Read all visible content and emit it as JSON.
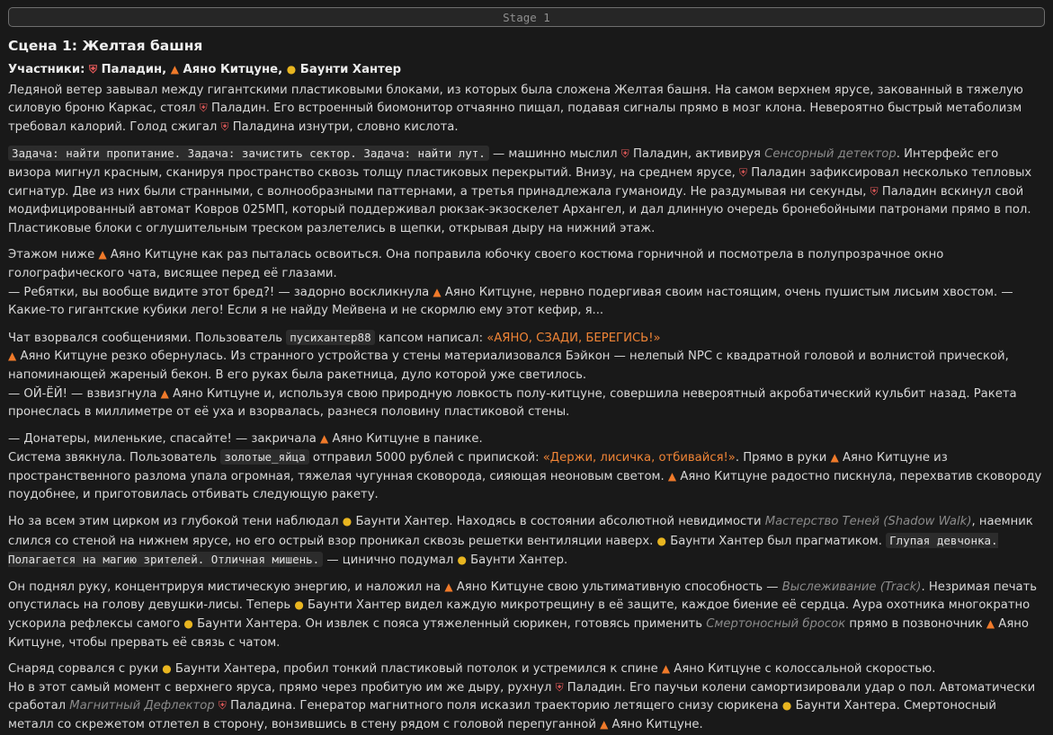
{
  "stage_button": "Stage 1",
  "scene_title": "Сцена 1: Желтая башня",
  "participants_label": "Участники:",
  "chars": {
    "paladin": "Паладин",
    "ayano": "Аяно Китцуне",
    "bounty": "Баунти Хантер"
  },
  "icons": {
    "paladin": "shield-icon",
    "ayano": "fox-icon",
    "bounty": "money-bag-icon"
  },
  "colors": {
    "highlight": "#f08436",
    "background": "#191919"
  },
  "paragraphs": [
    [
      {
        "t": "Ледяной ветер завывал между гигантскими пластиковыми блоками, из которых была сложена Желтая башня. На самом верхнем ярусе, закованный в тяжелую силовую броню Каркас, стоял "
      },
      {
        "c": "paladin",
        "t": "Паладин"
      },
      {
        "t": ". Его встроенный биомонитор отчаянно пищал, подавая сигналы прямо в мозг клона. Невероятно быстрый метаболизм требовал калорий. Голод сжигал "
      },
      {
        "c": "paladin",
        "t": "Паладина"
      },
      {
        "t": " изнутри, словно кислота."
      }
    ],
    [
      {
        "code": "Задача: найти пропитание. Задача: зачистить сектор. Задача: найти лут."
      },
      {
        "t": " — машинно мыслил "
      },
      {
        "c": "paladin",
        "t": "Паладин"
      },
      {
        "t": ", активируя "
      },
      {
        "em": "Сенсорный детектор"
      },
      {
        "t": ". Интерфейс его визора мигнул красным, сканируя пространство сквозь толщу пластиковых перекрытий. Внизу, на среднем ярусе, "
      },
      {
        "c": "paladin",
        "t": "Паладин"
      },
      {
        "t": " зафиксировал несколько тепловых сигнатур. Две из них были странными, с волнообразными паттернами, а третья принадлежала гуманоиду. Не раздумывая ни секунды, "
      },
      {
        "c": "paladin",
        "t": "Паладин"
      },
      {
        "t": " вскинул свой модифицированный автомат Ковров 025МП, который поддерживал рюкзак-экзоскелет Архангел, и дал длинную очередь бронебойными патронами прямо в пол. Пластиковые блоки с оглушительным треском разлетелись в щепки, открывая дыру на нижний этаж."
      }
    ],
    [
      {
        "t": "Этажом ниже "
      },
      {
        "c": "ayano",
        "t": "Аяно Китцуне"
      },
      {
        "t": " как раз пыталась освоиться. Она поправила юбочку своего костюма горничной и посмотрела в полупрозрачное окно голографического чата, висящее перед её глазами."
      },
      {
        "br": true
      },
      {
        "t": "— Ребятки, вы вообще видите этот бред?! — задорно воскликнула "
      },
      {
        "c": "ayano",
        "t": "Аяно Китцуне"
      },
      {
        "t": ", нервно подергивая своим настоящим, очень пушистым лисьим хвостом. — Какие-то гигантские кубики лего! Если я не найду Мейвена и не скормлю ему этот кефир, я..."
      }
    ],
    [
      {
        "t": "Чат взорвался сообщениями. Пользователь "
      },
      {
        "code": "пусихантер88"
      },
      {
        "t": " капсом написал: "
      },
      {
        "hl": "«АЯНО, СЗАДИ, БЕРЕГИСЬ!»"
      },
      {
        "br": true
      },
      {
        "c": "ayano",
        "t": "Аяно Китцуне"
      },
      {
        "t": " резко обернулась. Из странного устройства у стены материализовался Бэйкон — нелепый NPC с квадратной головой и волнистой прической, напоминающей жареный бекон. В его руках была ракетница, дуло которой уже светилось."
      },
      {
        "br": true
      },
      {
        "t": "— ОЙ-ЁЙ! — взвизгнула "
      },
      {
        "c": "ayano",
        "t": "Аяно Китцуне"
      },
      {
        "t": " и, используя свою природную ловкость полу-китцуне, совершила невероятный акробатический кульбит назад. Ракета пронеслась в миллиметре от её уха и взорвалась, разнеся половину пластиковой стены."
      }
    ],
    [
      {
        "t": "— Донатеры, миленькие, спасайте! — закричала "
      },
      {
        "c": "ayano",
        "t": "Аяно Китцуне"
      },
      {
        "t": " в панике."
      },
      {
        "br": true
      },
      {
        "t": "Система звякнула. Пользователь "
      },
      {
        "code": "золотые_яйца"
      },
      {
        "t": " отправил 5000 рублей с припиской: "
      },
      {
        "hl": "«Держи, лисичка, отбивайся!»"
      },
      {
        "t": ". Прямо в руки "
      },
      {
        "c": "ayano",
        "t": "Аяно Китцуне"
      },
      {
        "t": " из пространственного разлома упала огромная, тяжелая чугунная сковорода, сияющая неоновым светом. "
      },
      {
        "c": "ayano",
        "t": "Аяно Китцуне"
      },
      {
        "t": " радостно пискнула, перехватив сковороду поудобнее, и приготовилась отбивать следующую ракету."
      }
    ],
    [
      {
        "t": "Но за всем этим цирком из глубокой тени наблюдал "
      },
      {
        "c": "bounty",
        "t": "Баунти Хантер"
      },
      {
        "t": ". Находясь в состоянии абсолютной невидимости "
      },
      {
        "em": "Мастерство Теней (Shadow Walk)"
      },
      {
        "t": ", наемник слился со стеной на нижнем ярусе, но его острый взор проникал сквозь решетки вентиляции наверх. "
      },
      {
        "c": "bounty",
        "t": "Баунти Хантер"
      },
      {
        "t": " был прагматиком. "
      },
      {
        "code": "Глупая девчонка. Полагается на магию зрителей. Отличная мишень."
      },
      {
        "t": " — цинично подумал "
      },
      {
        "c": "bounty",
        "t": "Баунти Хантер"
      },
      {
        "t": "."
      }
    ],
    [
      {
        "t": "Он поднял руку, концентрируя мистическую энергию, и наложил на "
      },
      {
        "c": "ayano",
        "t": "Аяно Китцуне"
      },
      {
        "t": " свою ультимативную способность — "
      },
      {
        "em": "Выслеживание (Track)"
      },
      {
        "t": ". Незримая печать опустилась на голову девушки-лисы. Теперь "
      },
      {
        "c": "bounty",
        "t": "Баунти Хантер"
      },
      {
        "t": " видел каждую микротрещину в её защите, каждое биение её сердца. Аура охотника многократно ускорила рефлексы самого "
      },
      {
        "c": "bounty",
        "t": "Баунти Хантера"
      },
      {
        "t": ". Он извлек с пояса утяжеленный сюрикен, готовясь применить "
      },
      {
        "em": "Смертоносный бросок"
      },
      {
        "t": " прямо в позвоночник "
      },
      {
        "c": "ayano",
        "t": "Аяно Китцуне"
      },
      {
        "t": ", чтобы прервать её связь с чатом."
      }
    ],
    [
      {
        "t": "Снаряд сорвался с руки "
      },
      {
        "c": "bounty",
        "t": "Баунти Хантера"
      },
      {
        "t": ", пробил тонкий пластиковый потолок и устремился к спине "
      },
      {
        "c": "ayano",
        "t": "Аяно Китцуне"
      },
      {
        "t": " с колоссальной скоростью."
      },
      {
        "br": true
      },
      {
        "t": "Но в этот самый момент с верхнего яруса, прямо через пробитую им же дыру, рухнул "
      },
      {
        "c": "paladin",
        "t": "Паладин"
      },
      {
        "t": ". Его паучьи колени самортизировали удар о пол. Автоматически сработал "
      },
      {
        "em": "Магнитный Дефлектор"
      },
      {
        "t": " "
      },
      {
        "c": "paladin",
        "t": "Паладина"
      },
      {
        "t": ". Генератор магнитного поля исказил траекторию летящего снизу сюрикена "
      },
      {
        "c": "bounty",
        "t": "Баунти Хантера"
      },
      {
        "t": ". Смертоносный металл со скрежетом отлетел в сторону, вонзившись в стену рядом с головой перепуганной "
      },
      {
        "c": "ayano",
        "t": "Аяно Китцуне"
      },
      {
        "t": "."
      }
    ]
  ]
}
